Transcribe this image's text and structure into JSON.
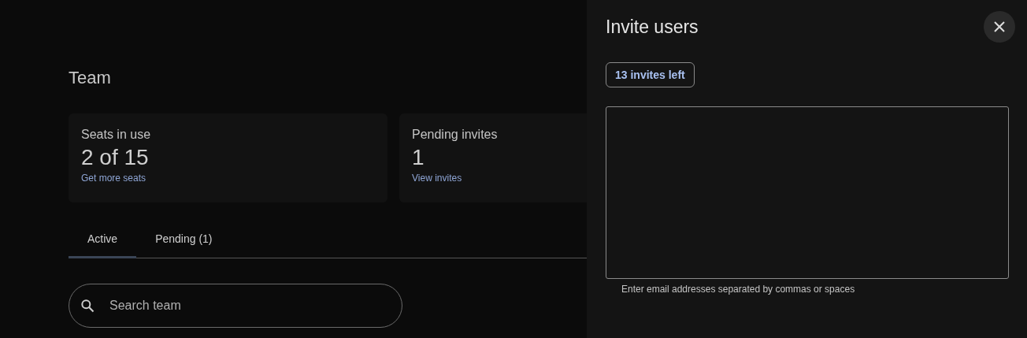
{
  "page": {
    "title": "Team"
  },
  "stats": [
    {
      "label": "Seats in use",
      "value": "2 of 15",
      "link": "Get more seats"
    },
    {
      "label": "Pending invites",
      "value": "1",
      "link": "View invites"
    }
  ],
  "tabs": [
    {
      "label": "Active",
      "selected": true
    },
    {
      "label": "Pending (1)",
      "selected": false
    }
  ],
  "search": {
    "placeholder": "Search team"
  },
  "invite_panel": {
    "title": "Invite users",
    "invites_left": "13 invites left",
    "helper": "Enter email addresses separated by commas or spaces"
  }
}
